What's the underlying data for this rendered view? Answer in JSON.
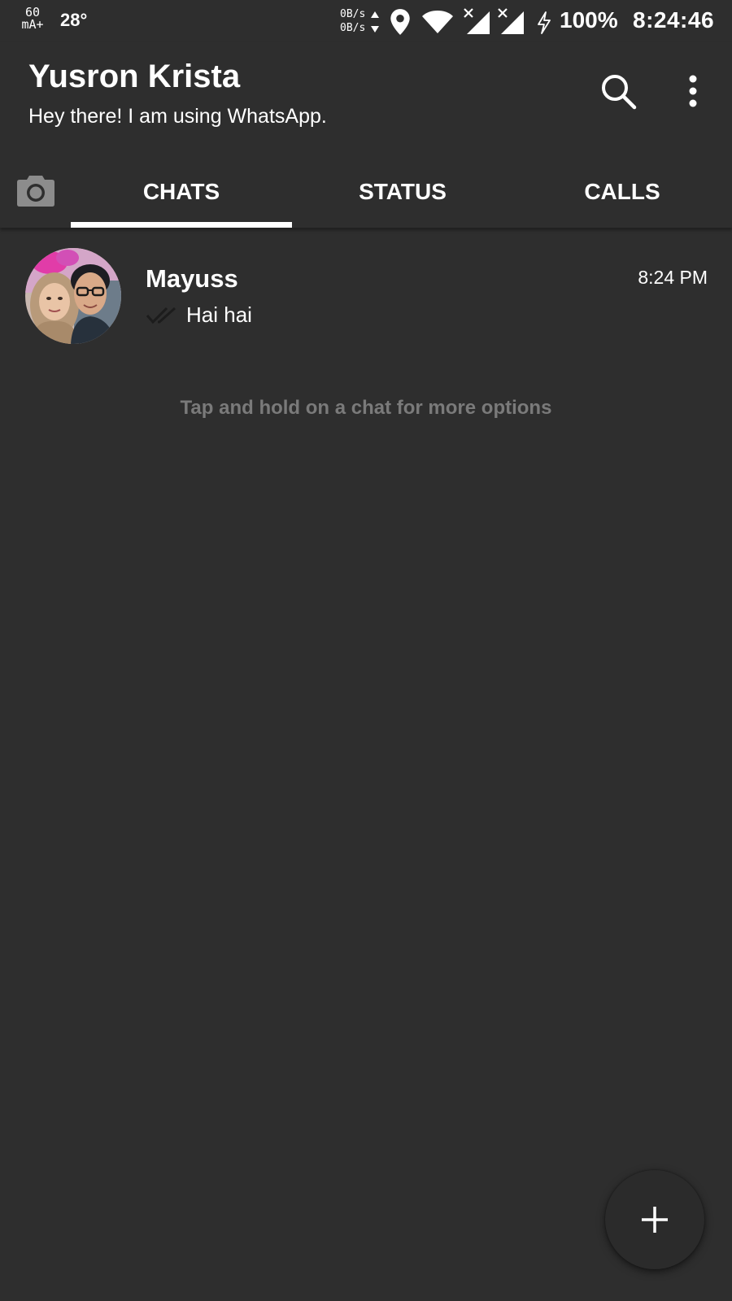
{
  "status_bar": {
    "current_value": "60",
    "current_unit": "mA+",
    "temperature": "28°",
    "net_up": "0B/s",
    "net_down": "0B/s",
    "battery": "100%",
    "time": "8:24:46",
    "icons": [
      "location-icon",
      "wifi-icon",
      "signal-icon",
      "signal-icon",
      "charging-icon"
    ]
  },
  "header": {
    "name": "Yusron Krista",
    "status": "Hey there! I am using WhatsApp."
  },
  "tabs": {
    "items": [
      {
        "label": "CHATS",
        "active": true
      },
      {
        "label": "STATUS",
        "active": false
      },
      {
        "label": "CALLS",
        "active": false
      }
    ]
  },
  "chats": [
    {
      "name": "Mayuss",
      "time": "8:24 PM",
      "preview": "Hai hai"
    }
  ],
  "hint": "Tap and hold on a chat for more options",
  "colors": {
    "background": "#2e2e2e",
    "text": "#ffffff",
    "hint": "#7a7a7a",
    "fab": "#2b2b2b"
  }
}
